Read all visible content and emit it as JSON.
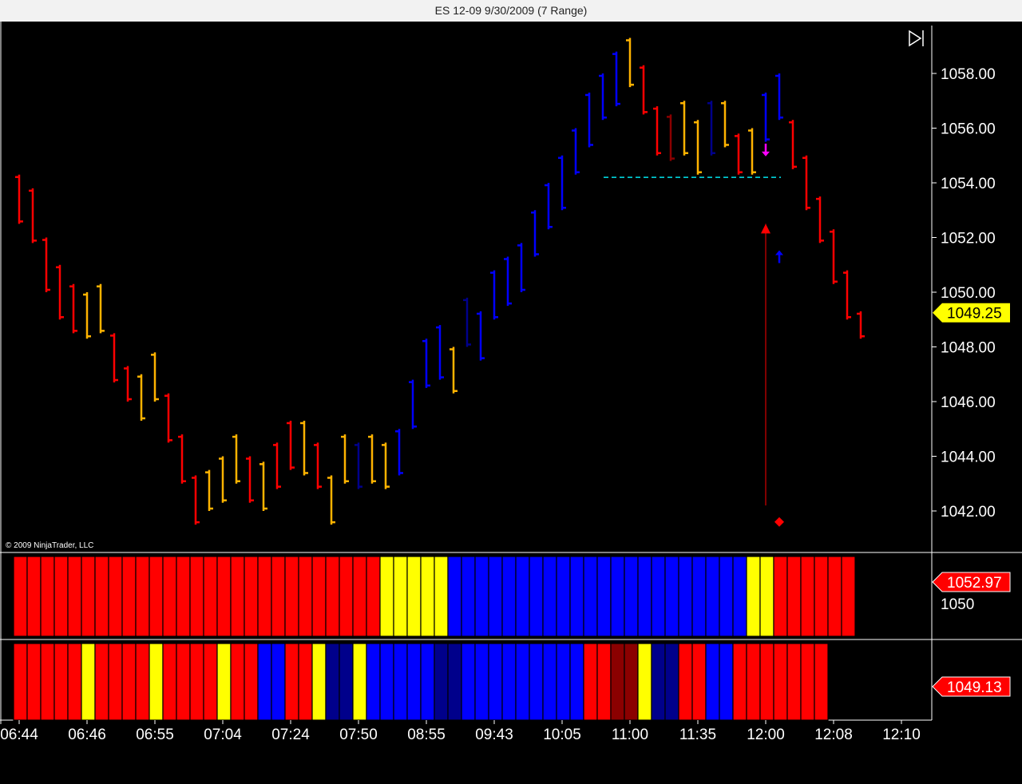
{
  "window": {
    "title": "ES 12-09  9/30/2009 (7 Range)"
  },
  "copyright": "© 2009 NinjaTrader, LLC",
  "colors": {
    "red": "#ff0000",
    "blue": "#0000ff",
    "yellow": "#ffff00",
    "orange": "#ffb300",
    "darkred": "#8b0000",
    "navy": "#00008b",
    "cyan": "#00e5ee",
    "magenta": "#ff00ff"
  },
  "chart_data": {
    "type": "bar",
    "price_panel": {
      "ylim": [
        1040.5,
        1060
      ],
      "yticks": [
        "1042.00",
        "1044.00",
        "1046.00",
        "1048.00",
        "1050.00",
        "1052.00",
        "1054.00",
        "1056.00",
        "1058.00"
      ],
      "last_price_label": "1049.25",
      "last_price": 1049.25,
      "bars": [
        {
          "h": 1054.3,
          "l": 1052.5,
          "c": "red"
        },
        {
          "h": 1053.8,
          "l": 1051.8,
          "c": "red"
        },
        {
          "h": 1052.0,
          "l": 1050.0,
          "c": "red"
        },
        {
          "h": 1051.0,
          "l": 1049.0,
          "c": "red"
        },
        {
          "h": 1050.3,
          "l": 1048.5,
          "c": "red"
        },
        {
          "h": 1050.0,
          "l": 1048.3,
          "c": "orange"
        },
        {
          "h": 1050.3,
          "l": 1048.5,
          "c": "orange"
        },
        {
          "h": 1048.5,
          "l": 1046.7,
          "c": "red"
        },
        {
          "h": 1047.3,
          "l": 1046.0,
          "c": "red"
        },
        {
          "h": 1047.0,
          "l": 1045.3,
          "c": "orange"
        },
        {
          "h": 1047.8,
          "l": 1046.0,
          "c": "orange"
        },
        {
          "h": 1046.3,
          "l": 1044.5,
          "c": "red"
        },
        {
          "h": 1044.8,
          "l": 1043.0,
          "c": "red"
        },
        {
          "h": 1043.3,
          "l": 1041.5,
          "c": "red"
        },
        {
          "h": 1043.5,
          "l": 1042.0,
          "c": "orange"
        },
        {
          "h": 1044.0,
          "l": 1042.3,
          "c": "orange"
        },
        {
          "h": 1044.8,
          "l": 1043.0,
          "c": "orange"
        },
        {
          "h": 1044.0,
          "l": 1042.3,
          "c": "red"
        },
        {
          "h": 1043.8,
          "l": 1042.0,
          "c": "orange"
        },
        {
          "h": 1044.5,
          "l": 1042.8,
          "c": "red"
        },
        {
          "h": 1045.3,
          "l": 1043.5,
          "c": "red"
        },
        {
          "h": 1045.3,
          "l": 1043.3,
          "c": "orange"
        },
        {
          "h": 1044.5,
          "l": 1042.8,
          "c": "red"
        },
        {
          "h": 1043.3,
          "l": 1041.5,
          "c": "orange"
        },
        {
          "h": 1044.8,
          "l": 1043.0,
          "c": "orange"
        },
        {
          "h": 1044.5,
          "l": 1042.8,
          "c": "navy"
        },
        {
          "h": 1044.8,
          "l": 1043.0,
          "c": "orange"
        },
        {
          "h": 1044.5,
          "l": 1042.8,
          "c": "orange"
        },
        {
          "h": 1045.0,
          "l": 1043.3,
          "c": "blue"
        },
        {
          "h": 1046.8,
          "l": 1045.0,
          "c": "blue"
        },
        {
          "h": 1048.3,
          "l": 1046.5,
          "c": "blue"
        },
        {
          "h": 1048.8,
          "l": 1046.8,
          "c": "blue"
        },
        {
          "h": 1048.0,
          "l": 1046.3,
          "c": "orange"
        },
        {
          "h": 1049.8,
          "l": 1048.0,
          "c": "navy"
        },
        {
          "h": 1049.3,
          "l": 1047.5,
          "c": "blue"
        },
        {
          "h": 1050.8,
          "l": 1049.0,
          "c": "blue"
        },
        {
          "h": 1051.3,
          "l": 1049.5,
          "c": "blue"
        },
        {
          "h": 1051.8,
          "l": 1050.0,
          "c": "blue"
        },
        {
          "h": 1053.0,
          "l": 1051.3,
          "c": "blue"
        },
        {
          "h": 1054.0,
          "l": 1052.3,
          "c": "blue"
        },
        {
          "h": 1055.0,
          "l": 1053.0,
          "c": "blue"
        },
        {
          "h": 1056.0,
          "l": 1054.3,
          "c": "blue"
        },
        {
          "h": 1057.3,
          "l": 1055.3,
          "c": "blue"
        },
        {
          "h": 1058.0,
          "l": 1056.3,
          "c": "blue"
        },
        {
          "h": 1058.8,
          "l": 1056.8,
          "c": "blue"
        },
        {
          "h": 1059.3,
          "l": 1057.5,
          "c": "orange"
        },
        {
          "h": 1058.3,
          "l": 1056.5,
          "c": "red"
        },
        {
          "h": 1056.8,
          "l": 1055.0,
          "c": "red"
        },
        {
          "h": 1056.5,
          "l": 1054.8,
          "c": "darkred"
        },
        {
          "h": 1057.0,
          "l": 1055.0,
          "c": "orange"
        },
        {
          "h": 1056.3,
          "l": 1054.3,
          "c": "orange"
        },
        {
          "h": 1057.0,
          "l": 1055.0,
          "c": "navy"
        },
        {
          "h": 1057.0,
          "l": 1055.3,
          "c": "orange"
        },
        {
          "h": 1055.8,
          "l": 1054.3,
          "c": "red"
        },
        {
          "h": 1056.0,
          "l": 1054.3,
          "c": "orange"
        },
        {
          "h": 1057.3,
          "l": 1055.5,
          "c": "blue"
        },
        {
          "h": 1058.0,
          "l": 1056.3,
          "c": "blue"
        },
        {
          "h": 1056.3,
          "l": 1054.5,
          "c": "red"
        },
        {
          "h": 1055.0,
          "l": 1053.0,
          "c": "red"
        },
        {
          "h": 1053.5,
          "l": 1051.8,
          "c": "red"
        },
        {
          "h": 1052.3,
          "l": 1050.3,
          "c": "red"
        },
        {
          "h": 1050.8,
          "l": 1049.0,
          "c": "red"
        },
        {
          "h": 1049.3,
          "l": 1048.3,
          "c": "red"
        }
      ],
      "support_line": {
        "price": 1054.2,
        "from_bar": 44,
        "to_bar": 56,
        "color": "cyan"
      },
      "signals": [
        {
          "type": "down-arrow",
          "bar": 55,
          "price": 1055.2,
          "color": "magenta"
        },
        {
          "type": "up-arrow",
          "bar": 56,
          "price": 1051.3,
          "color": "blue"
        },
        {
          "type": "up-arrow-line",
          "bar": 55,
          "top": 1052.5,
          "bottom": 1042.2,
          "color": "red"
        },
        {
          "type": "diamond",
          "bar": 56,
          "price": 1041.6,
          "color": "red"
        }
      ]
    },
    "indicator_panel_1": {
      "value_label": "1052.97",
      "ytick": "1050",
      "colors": [
        "red",
        "red",
        "red",
        "red",
        "red",
        "red",
        "red",
        "red",
        "red",
        "red",
        "red",
        "red",
        "red",
        "red",
        "red",
        "red",
        "red",
        "red",
        "red",
        "red",
        "red",
        "red",
        "red",
        "red",
        "red",
        "red",
        "red",
        "yellow",
        "yellow",
        "yellow",
        "yellow",
        "yellow",
        "blue",
        "blue",
        "blue",
        "blue",
        "blue",
        "blue",
        "blue",
        "blue",
        "blue",
        "blue",
        "blue",
        "blue",
        "blue",
        "blue",
        "blue",
        "blue",
        "blue",
        "blue",
        "blue",
        "blue",
        "blue",
        "blue",
        "yellow",
        "yellow",
        "red",
        "red",
        "red",
        "red",
        "red",
        "red"
      ]
    },
    "indicator_panel_2": {
      "value_label": "1049.13",
      "colors": [
        "red",
        "red",
        "red",
        "red",
        "red",
        "yellow",
        "red",
        "red",
        "red",
        "red",
        "yellow",
        "red",
        "red",
        "red",
        "red",
        "yellow",
        "red",
        "red",
        "blue",
        "blue",
        "red",
        "red",
        "yellow",
        "navy",
        "navy",
        "yellow",
        "blue",
        "blue",
        "blue",
        "blue",
        "blue",
        "navy",
        "navy",
        "blue",
        "blue",
        "blue",
        "blue",
        "blue",
        "blue",
        "blue",
        "blue",
        "blue",
        "red",
        "red",
        "darkred",
        "darkred",
        "yellow",
        "navy",
        "navy",
        "red",
        "red",
        "blue",
        "blue",
        "red",
        "red",
        "red",
        "red",
        "red",
        "red",
        "red"
      ]
    },
    "x_axis": {
      "labels": [
        "06:44",
        "06:46",
        "06:55",
        "07:04",
        "07:24",
        "07:50",
        "08:55",
        "09:43",
        "10:05",
        "11:00",
        "11:35",
        "12:00",
        "12:08",
        "12:10"
      ]
    }
  }
}
